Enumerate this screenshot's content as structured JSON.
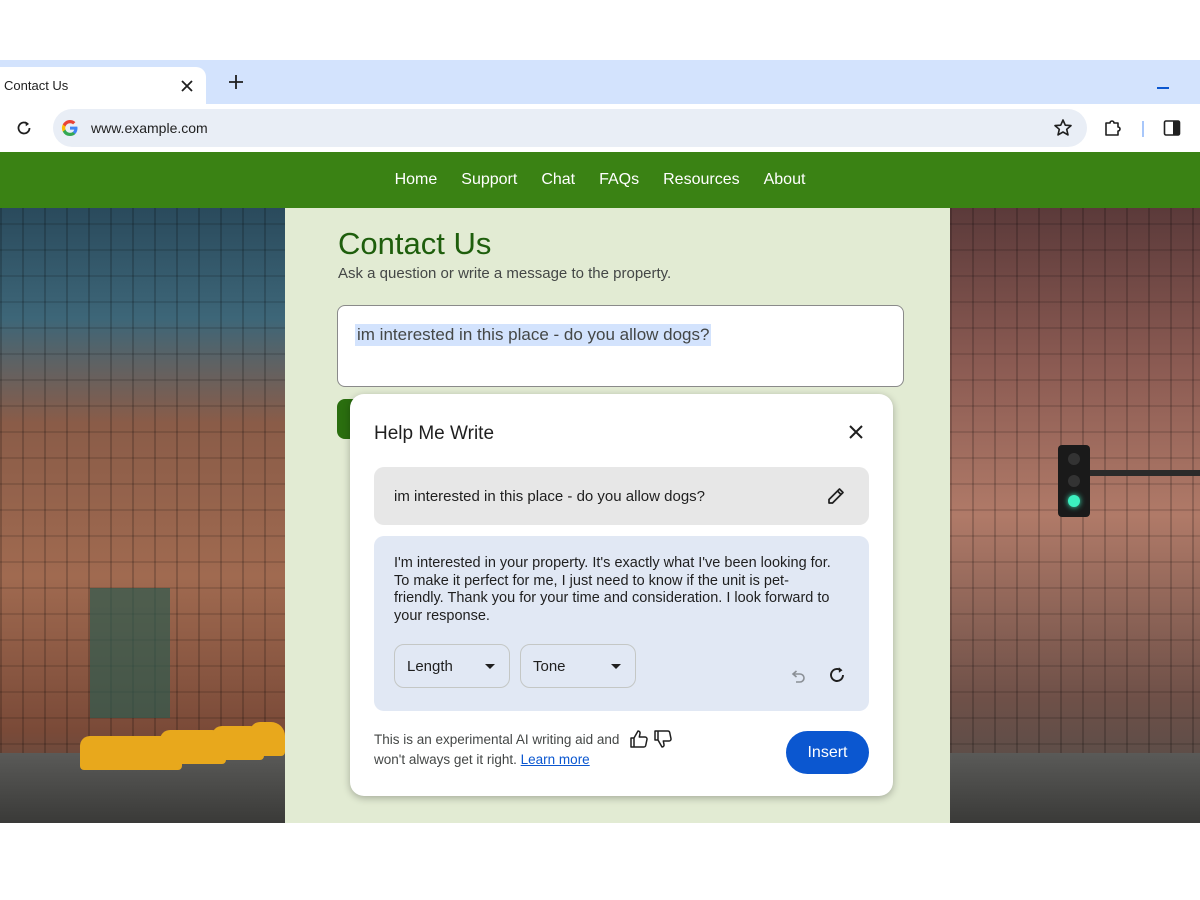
{
  "browser": {
    "tab_title": "Contact Us",
    "url": "www.example.com"
  },
  "nav": {
    "items": [
      "Home",
      "Support",
      "Chat",
      "FAQs",
      "Resources",
      "About"
    ]
  },
  "page": {
    "title": "Contact Us",
    "subtitle": "Ask a question or write a message to the property.",
    "message": "im interested in this place - do you allow dogs?"
  },
  "help_me_write": {
    "title": "Help Me Write",
    "prompt": "im interested in this place - do you allow dogs?",
    "result": "I'm interested in your property. It's exactly what I've been looking for. To make it perfect for me, I just need to know if the unit is pet-friendly. Thank you for your time and consideration. I look forward to your response.",
    "length_label": "Length",
    "tone_label": "Tone",
    "disclaimer": "This is an experimental AI writing aid and won't always get it right.",
    "learn_more": "Learn more",
    "insert_label": "Insert"
  },
  "colors": {
    "nav_green": "#3a8214",
    "title_green": "#1e5e0c",
    "content_bg": "#e2ebd3",
    "chrome_blue": "#d3e3fd",
    "insert_blue": "#0b57d0"
  }
}
